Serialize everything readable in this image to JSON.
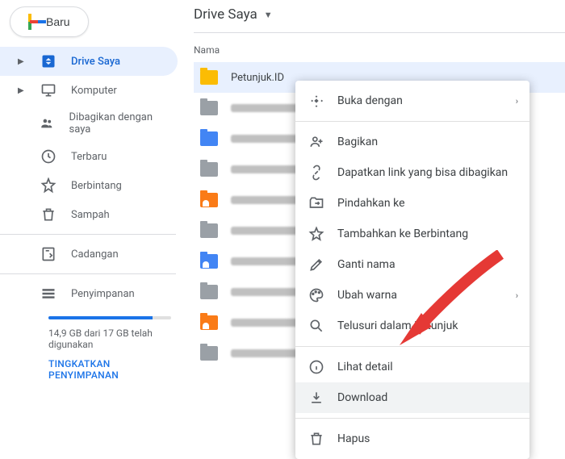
{
  "new_button": {
    "label": "Baru"
  },
  "sidebar": {
    "my_drive": "Drive Saya",
    "computers": "Komputer",
    "shared": "Dibagikan dengan saya",
    "recent": "Terbaru",
    "starred": "Berbintang",
    "trash": "Sampah",
    "backups": "Cadangan",
    "storage": "Penyimpanan"
  },
  "storage": {
    "text": "14,9 GB dari 17 GB telah digunakan",
    "upgrade": "TINGKATKAN PENYIMPANAN"
  },
  "breadcrumb": "Drive Saya",
  "column_header": "Nama",
  "files": {
    "selected": "Petunjuk.ID"
  },
  "context_menu": {
    "open_with": "Buka dengan",
    "share": "Bagikan",
    "get_link": "Dapatkan link yang bisa dibagikan",
    "move_to": "Pindahkan ke",
    "add_star": "Tambahkan ke Berbintang",
    "rename": "Ganti nama",
    "change_color": "Ubah warna",
    "search_in": "Telusuri dalam Petunjuk",
    "view_details": "Lihat detail",
    "download": "Download",
    "remove": "Hapus"
  }
}
